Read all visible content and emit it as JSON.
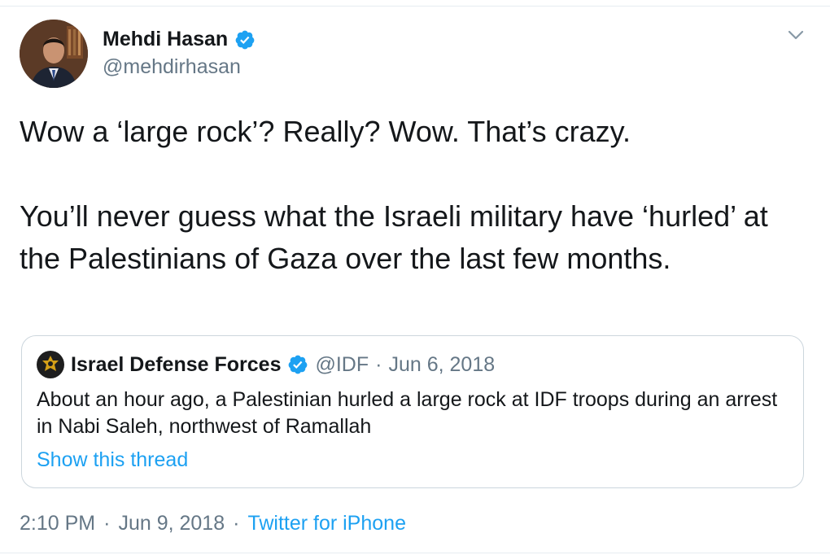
{
  "tweet": {
    "author": {
      "name": "Mehdi Hasan",
      "handle": "@mehdirhasan",
      "verified": true
    },
    "text_paragraphs": [
      "Wow a ‘large rock’? Really? Wow. That’s crazy.",
      "You’ll never guess what the Israeli military have ‘hurled’ at the Palestinians of Gaza over the last few months."
    ],
    "quoted_tweet": {
      "author_name": "Israel Defense Forces",
      "verified": true,
      "handle": "@IDF",
      "separator": "·",
      "date": "Jun 6, 2018",
      "text": "About an hour ago, a Palestinian hurled a large rock at IDF troops during an arrest in Nabi Saleh, northwest of Ramallah",
      "thread_link": "Show this thread"
    },
    "meta": {
      "time": "2:10 PM",
      "separator": "·",
      "date": "Jun 9, 2018",
      "source": "Twitter for iPhone"
    }
  },
  "icons": {
    "verified": "verified-badge-icon",
    "caret": "chevron-down-icon",
    "idf_logo": "idf-emblem-icon"
  },
  "colors": {
    "accent": "#1da1f2",
    "text": "#14171a",
    "secondary": "#657786",
    "border": "#ccd6dd"
  }
}
